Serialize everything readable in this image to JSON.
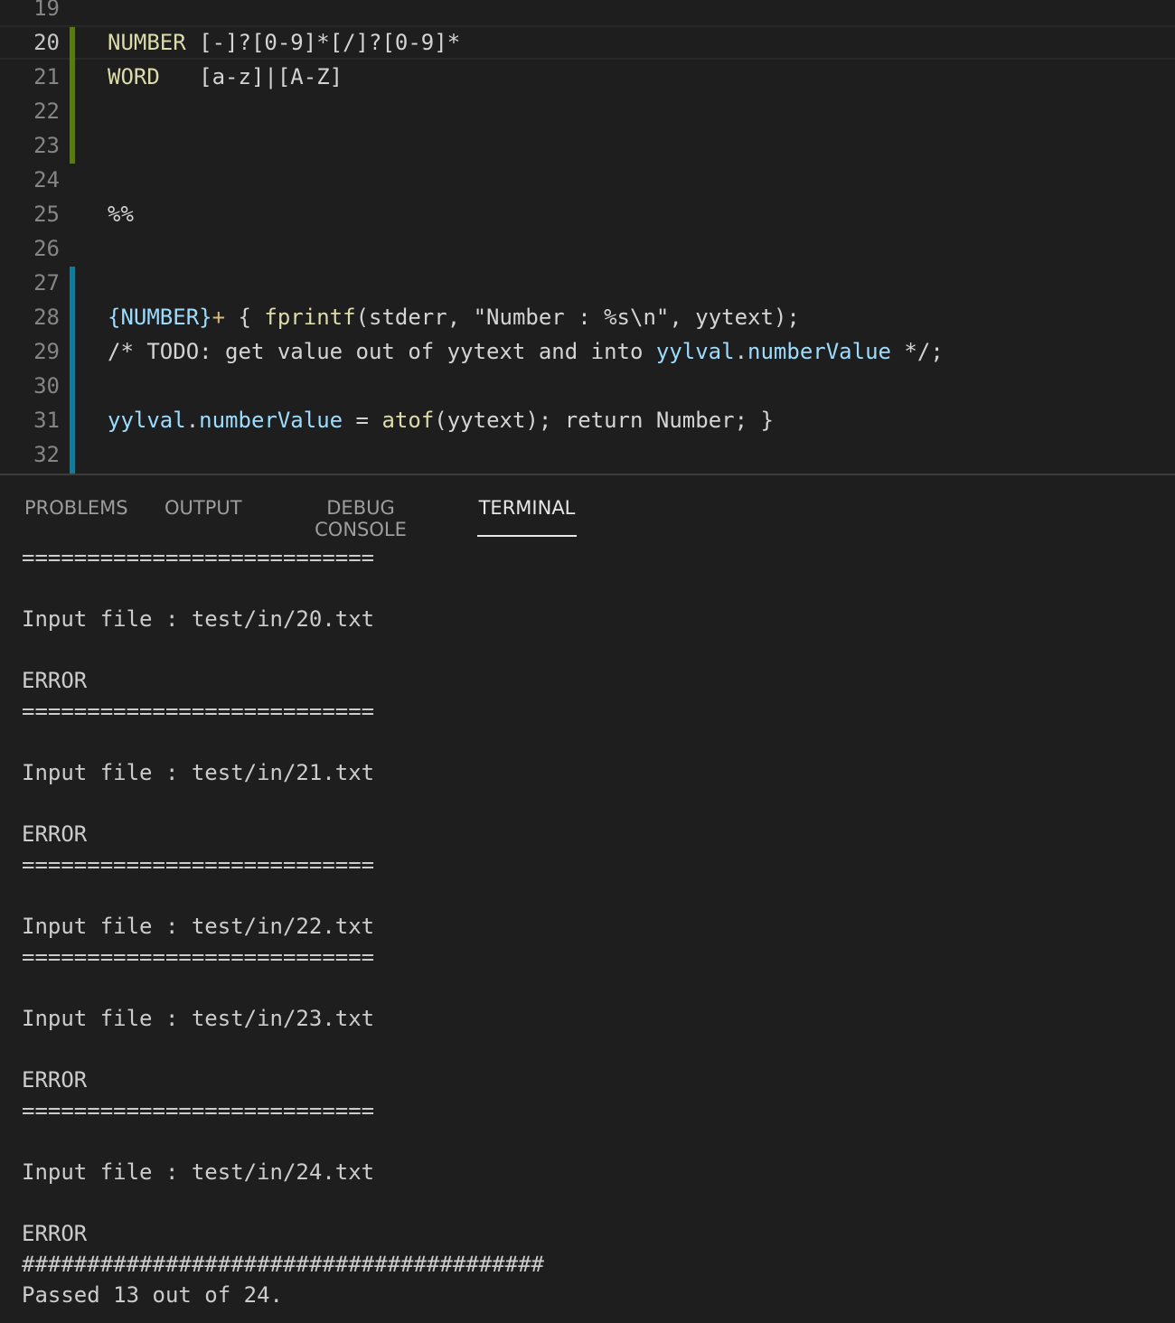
{
  "editor": {
    "lines": [
      {
        "num": "19",
        "segments": [
          {
            "text": "",
            "cls": "c-plain"
          }
        ]
      },
      {
        "num": "20",
        "active": true,
        "segments": [
          {
            "text": "NUMBER",
            "cls": "c-def"
          },
          {
            "text": " [-]?[0-9]*[/]?[0-9]*",
            "cls": "c-plain"
          }
        ]
      },
      {
        "num": "21",
        "segments": [
          {
            "text": "WORD",
            "cls": "c-def"
          },
          {
            "text": "   [a-z]|[A-Z]",
            "cls": "c-plain"
          }
        ]
      },
      {
        "num": "22",
        "segments": []
      },
      {
        "num": "23",
        "segments": []
      },
      {
        "num": "24",
        "segments": []
      },
      {
        "num": "25",
        "segments": [
          {
            "text": "%%",
            "cls": "c-plain"
          }
        ]
      },
      {
        "num": "26",
        "segments": []
      },
      {
        "num": "27",
        "segments": []
      },
      {
        "num": "28",
        "segments": [
          {
            "text": "{NUMBER}",
            "cls": "c-var"
          },
          {
            "text": "+",
            "cls": "c-op"
          },
          {
            "text": " { ",
            "cls": "c-plain"
          },
          {
            "text": "fprintf",
            "cls": "c-func"
          },
          {
            "text": "(stderr, \"Number : %s\\n\", yytext);",
            "cls": "c-plain"
          }
        ]
      },
      {
        "num": "29",
        "segments": [
          {
            "text": "/* TODO: get value out of yytext and into ",
            "cls": "c-plain"
          },
          {
            "text": "yylval",
            "cls": "c-var"
          },
          {
            "text": ".",
            "cls": "c-plain"
          },
          {
            "text": "numberValue",
            "cls": "c-var"
          },
          {
            "text": " */;",
            "cls": "c-plain"
          }
        ]
      },
      {
        "num": "30",
        "segments": []
      },
      {
        "num": "31",
        "segments": [
          {
            "text": "yylval",
            "cls": "c-var"
          },
          {
            "text": ".",
            "cls": "c-plain"
          },
          {
            "text": "numberValue",
            "cls": "c-var"
          },
          {
            "text": " = ",
            "cls": "c-plain"
          },
          {
            "text": "atof",
            "cls": "c-func"
          },
          {
            "text": "(yytext); return Number; }",
            "cls": "c-plain"
          }
        ]
      },
      {
        "num": "32",
        "segments": []
      }
    ]
  },
  "panel": {
    "tabs": [
      {
        "label": "PROBLEMS",
        "active": false
      },
      {
        "label": "OUTPUT",
        "active": false
      },
      {
        "label": "DEBUG CONSOLE",
        "active": false
      },
      {
        "label": "TERMINAL",
        "active": true
      }
    ]
  },
  "terminal": {
    "lines": [
      "===========================",
      "",
      "Input file : test/in/20.txt",
      "",
      "ERROR",
      "===========================",
      "",
      "Input file : test/in/21.txt",
      "",
      "ERROR",
      "===========================",
      "",
      "Input file : test/in/22.txt",
      "===========================",
      "",
      "Input file : test/in/23.txt",
      "",
      "ERROR",
      "===========================",
      "",
      "Input file : test/in/24.txt",
      "",
      "ERROR",
      "########################################",
      "Passed 13 out of 24."
    ]
  }
}
